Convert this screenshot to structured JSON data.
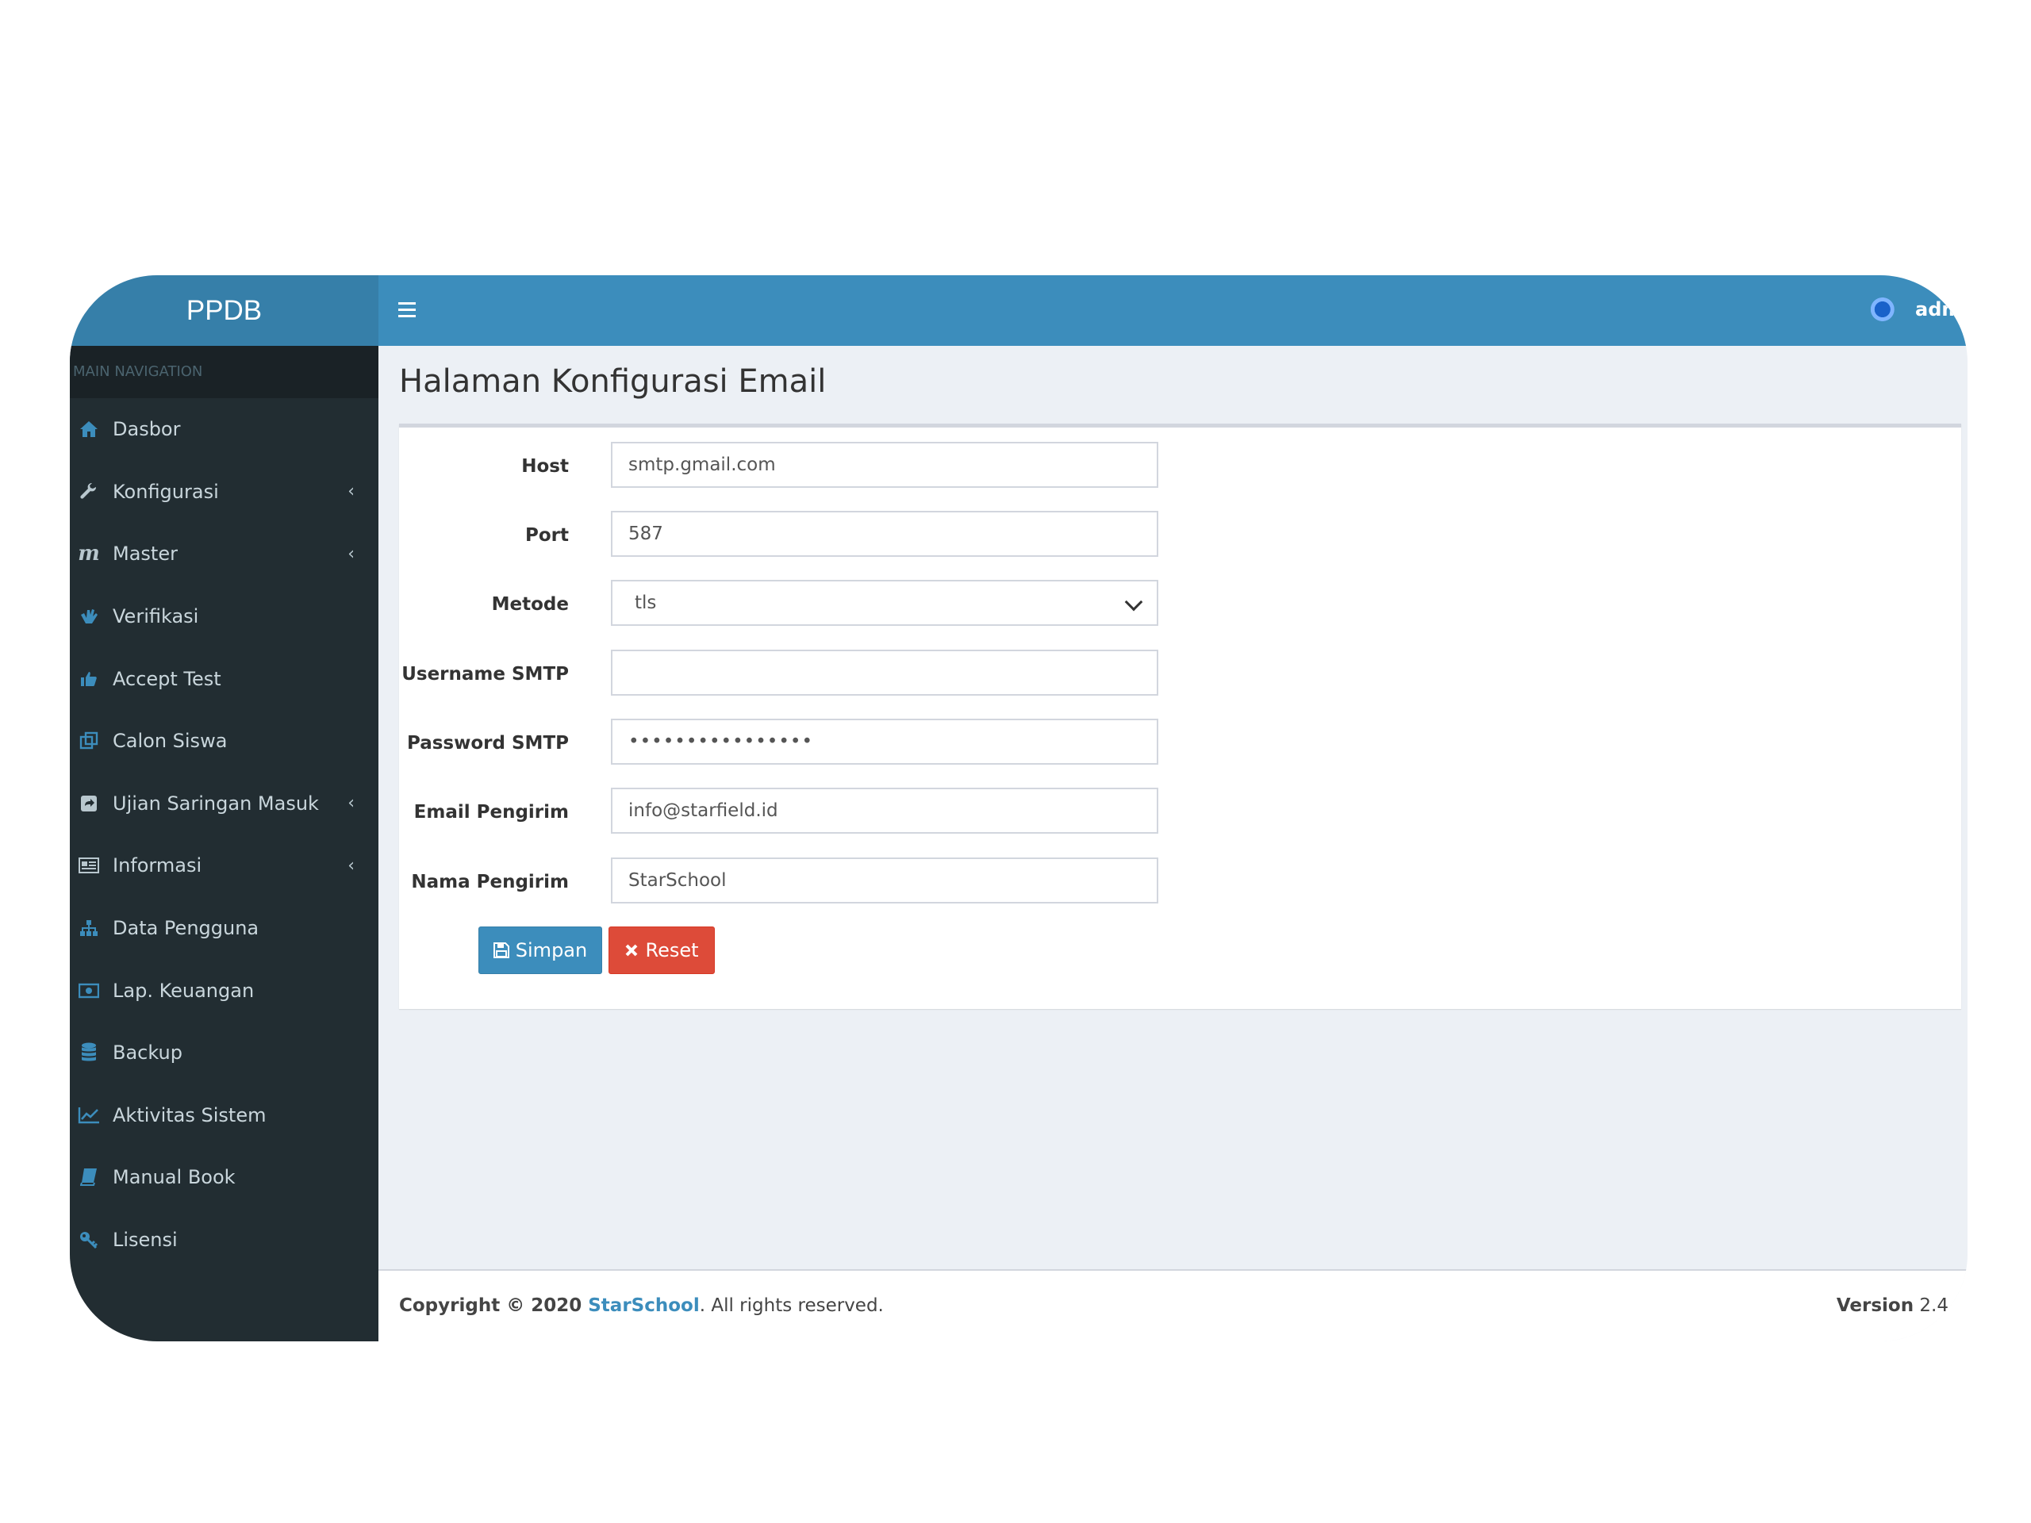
{
  "brand": {
    "logo_text": "PPDB"
  },
  "header": {
    "user_name": "admin"
  },
  "sidebar": {
    "header": "MAIN NAVIGATION",
    "items": [
      {
        "label": "Dasbor",
        "icon": "home-icon",
        "has_submenu": false
      },
      {
        "label": "Konfigurasi",
        "icon": "wrench-icon",
        "has_submenu": true
      },
      {
        "label": "Master",
        "icon": "m-icon",
        "has_submenu": true
      },
      {
        "label": "Verifikasi",
        "icon": "hand-icon",
        "has_submenu": false
      },
      {
        "label": "Accept Test",
        "icon": "thumbs-up-icon",
        "has_submenu": false
      },
      {
        "label": "Calon Siswa",
        "icon": "clone-icon",
        "has_submenu": false
      },
      {
        "label": "Ujian Saringan Masuk",
        "icon": "share-square-icon",
        "has_submenu": true
      },
      {
        "label": "Informasi",
        "icon": "newspaper-icon",
        "has_submenu": true
      },
      {
        "label": "Data Pengguna",
        "icon": "sitemap-icon",
        "has_submenu": false
      },
      {
        "label": "Lap. Keuangan",
        "icon": "money-icon",
        "has_submenu": false
      },
      {
        "label": "Backup",
        "icon": "database-icon",
        "has_submenu": false
      },
      {
        "label": "Aktivitas Sistem",
        "icon": "line-chart-icon",
        "has_submenu": false
      },
      {
        "label": "Manual Book",
        "icon": "book-icon",
        "has_submenu": false
      },
      {
        "label": "Lisensi",
        "icon": "key-icon",
        "has_submenu": false
      }
    ]
  },
  "page": {
    "title": "Halaman Konfigurasi Email"
  },
  "form": {
    "host": {
      "label": "Host",
      "value": "smtp.gmail.com"
    },
    "port": {
      "label": "Port",
      "value": "587"
    },
    "metode": {
      "label": "Metode",
      "value": "tls"
    },
    "username": {
      "label": "Username SMTP",
      "value": ""
    },
    "password": {
      "label": "Password SMTP",
      "value": "••••••••••••••••"
    },
    "email_pengirim": {
      "label": "Email Pengirim",
      "value": "info@starfield.id"
    },
    "nama_pengirim": {
      "label": "Nama Pengirim",
      "value": "StarSchool"
    },
    "save_label": "Simpan",
    "reset_label": "Reset"
  },
  "footer": {
    "copyright_prefix": "Copyright © 2020 ",
    "brand_link": "StarSchool",
    "copyright_suffix": ". All rights reserved.",
    "version_label": "Version",
    "version_value": "2.4"
  },
  "colors": {
    "header": "#3c8dbc",
    "logo_bg": "#367fa9",
    "sidebar": "#222d32",
    "primary": "#3c8dbc",
    "danger": "#dd4b39"
  }
}
